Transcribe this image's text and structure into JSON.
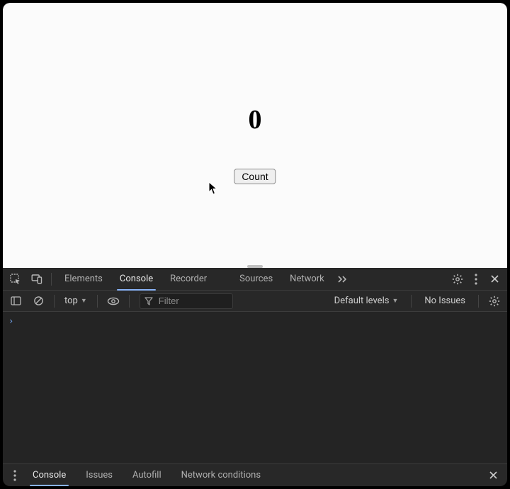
{
  "viewport": {
    "counter_value": "0",
    "button_label": "Count"
  },
  "devtools": {
    "tabs": {
      "elements": "Elements",
      "console": "Console",
      "recorder": "Recorder",
      "sources": "Sources",
      "network": "Network"
    },
    "filterbar": {
      "context": "top",
      "filter_placeholder": "Filter",
      "levels": "Default levels",
      "issues": "No Issues"
    },
    "drawer": {
      "console": "Console",
      "issues": "Issues",
      "autofill": "Autofill",
      "network_conditions": "Network conditions"
    }
  }
}
